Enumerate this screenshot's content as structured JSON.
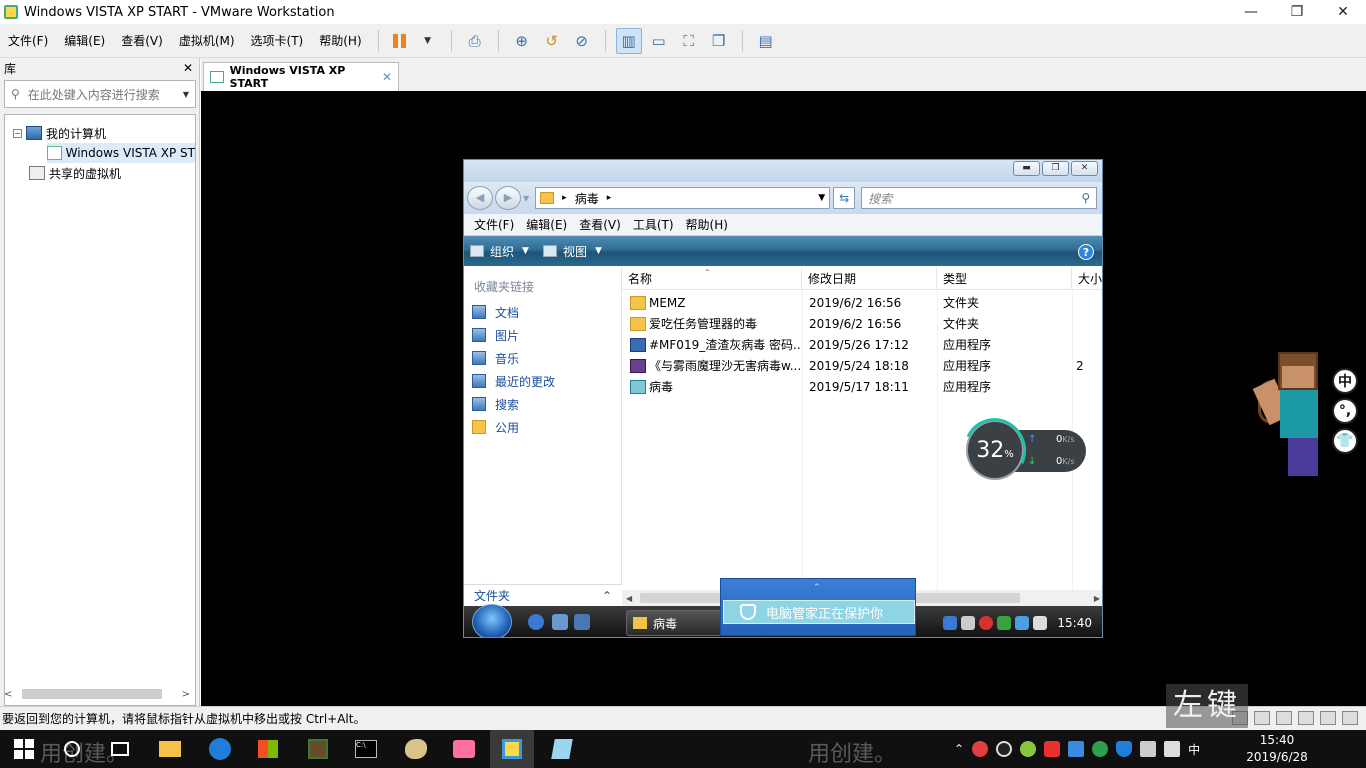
{
  "window": {
    "title": "Windows VISTA XP START - VMware Workstation",
    "controls": {
      "minimize": "—",
      "maximize": "❐",
      "close": "✕"
    }
  },
  "menubar": {
    "items": [
      "文件(F)",
      "编辑(E)",
      "查看(V)",
      "虚拟机(M)",
      "选项卡(T)",
      "帮助(H)"
    ]
  },
  "library": {
    "title": "库",
    "close": "✕",
    "search_placeholder": "在此处键入内容进行搜索",
    "tree": {
      "my_computer": "我的计算机",
      "vm_item": "Windows VISTA XP ST",
      "shared": "共享的虚拟机"
    },
    "scroll_left": "<",
    "scroll_right": ">"
  },
  "vm_tab": {
    "label": "Windows VISTA XP START",
    "close": "✕"
  },
  "guest": {
    "address": "病毒",
    "search_placeholder": "搜索",
    "menu": [
      "文件(F)",
      "编辑(E)",
      "查看(V)",
      "工具(T)",
      "帮助(H)"
    ],
    "commands": {
      "organize": "组织",
      "views": "视图"
    },
    "help": "?",
    "favorites": {
      "heading": "收藏夹链接",
      "items": [
        "文档",
        "图片",
        "音乐",
        "最近的更改",
        "搜索",
        "公用"
      ]
    },
    "folders_label": "文件夹",
    "columns": {
      "name": "名称",
      "date": "修改日期",
      "type": "类型",
      "size": "大小"
    },
    "files": [
      {
        "name": "MEMZ",
        "date": "2019/6/2 16:56",
        "type": "文件夹",
        "size": "",
        "icon": "folder"
      },
      {
        "name": "爱吃任务管理器的毒",
        "date": "2019/6/2 16:56",
        "type": "文件夹",
        "size": "",
        "icon": "folder"
      },
      {
        "name": "#MF019_渣渣灰病毒 密码...",
        "date": "2019/5/26 17:12",
        "type": "应用程序",
        "size": "",
        "icon": "exe"
      },
      {
        "name": "《与雾雨魔理沙无害病毒w...",
        "date": "2019/5/24 18:18",
        "type": "应用程序",
        "size": "2",
        "icon": "anime"
      },
      {
        "name": "病毒",
        "date": "2019/5/17 18:11",
        "type": "应用程序",
        "size": "",
        "icon": "virus"
      }
    ],
    "taskbar": {
      "task_label": "病毒",
      "clock": "15:40"
    }
  },
  "pc_manager_popup": {
    "text": "电脑管家正在保护你"
  },
  "speed_widget": {
    "percent": "32",
    "percent_sign": "%",
    "up": "0",
    "down": "0",
    "unit": "K/s"
  },
  "side_buttons": [
    "中",
    "°,",
    "👕"
  ],
  "statusbar": {
    "text": "要返回到您的计算机，请将鼠标指针从虚拟机中移出或按 Ctrl+Alt。"
  },
  "key_overlay": "左键",
  "host_taskbar": {
    "background_text_left": "用创建。",
    "background_text_right": "用创建。",
    "ime": "中",
    "time": "15:40",
    "date": "2019/6/28"
  }
}
